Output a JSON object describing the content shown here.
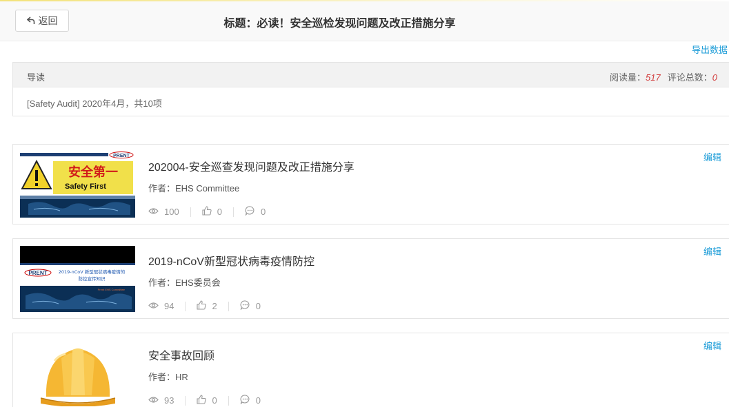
{
  "header": {
    "back_label": "返回",
    "title": "标题：必读！安全巡检发现问题及改正措施分享"
  },
  "export_label": "导出数据",
  "guide": {
    "title": "导读",
    "read_label": "阅读量：",
    "read_count": "517",
    "comment_label": "评论总数：",
    "comment_count": "0",
    "summary": "[Safety Audit] 2020年4月，共10项"
  },
  "articles": [
    {
      "title": "202004-安全巡查发现问题及改正措施分享",
      "author": "作者：EHS Committee",
      "views": "100",
      "likes": "0",
      "comments": "0",
      "edit_label": "编辑",
      "thumb": {
        "brand": "PRENT",
        "banner_cn": "安全第一",
        "banner_en": "Safety First"
      }
    },
    {
      "title": "2019-nCoV新型冠状病毒疫情防控",
      "author": "作者：EHS委员会",
      "views": "94",
      "likes": "2",
      "comments": "0",
      "edit_label": "编辑",
      "thumb": {
        "brand": "PRENT",
        "banner_line1": "2019-nCoV 新型冠状病毒疫情的",
        "banner_line2": "防控宣传知识",
        "footer": "Prent EHS Committee"
      }
    },
    {
      "title": "安全事故回顾",
      "author": "作者：HR",
      "views": "93",
      "likes": "0",
      "comments": "0",
      "edit_label": "编辑",
      "thumb": {
        "icon": "hard-hat-image"
      }
    }
  ],
  "colors": {
    "link": "#1a9bd7",
    "stat_number": "#d23c3c",
    "header_bg": "#f9f9f9",
    "panel_head_bg": "#f2f2f2"
  }
}
